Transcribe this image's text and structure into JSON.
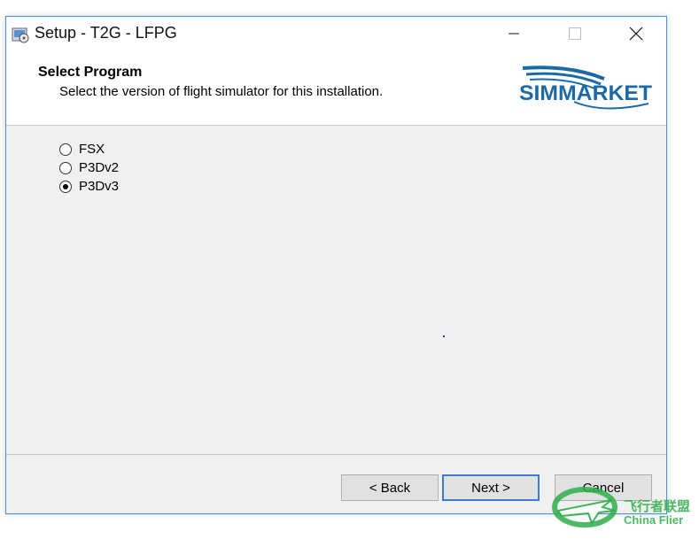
{
  "window": {
    "title": "Setup - T2G - LFPG"
  },
  "header": {
    "title": "Select Program",
    "subtitle": "Select the version of flight simulator for this installation.",
    "logo_text": "SIMMARKET"
  },
  "options": [
    {
      "label": "FSX",
      "selected": false
    },
    {
      "label": "P3Dv2",
      "selected": false
    },
    {
      "label": "P3Dv3",
      "selected": true
    }
  ],
  "buttons": {
    "back": "< Back",
    "next": "Next >",
    "cancel": "Cancel"
  },
  "watermark": {
    "cn": "飞行者联盟",
    "en": "China Flier"
  },
  "colors": {
    "border": "#4a8ed6",
    "next_border": "#3a7bd5",
    "logo": "#1b6aa6",
    "watermark": "#2eae4a"
  }
}
